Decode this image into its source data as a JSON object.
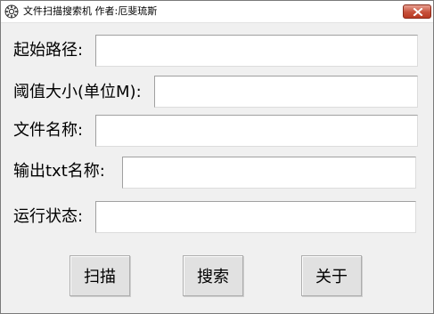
{
  "window": {
    "title": "文件扫描搜索机  作者:厄斐琉斯",
    "app_icon": "gear-icon",
    "close_icon": "close-icon",
    "close_color": "#c7503a"
  },
  "form": {
    "start_path_label": "起始路径:",
    "start_path_value": "",
    "threshold_label": "阈值大小(单位M):",
    "threshold_value": "",
    "filename_label": "文件名称:",
    "filename_value": "",
    "output_txt_label": "输出txt名称:",
    "output_txt_value": "",
    "run_status_label": "运行状态:",
    "run_status_value": ""
  },
  "buttons": {
    "scan": "扫描",
    "search": "搜索",
    "about": "关于"
  }
}
